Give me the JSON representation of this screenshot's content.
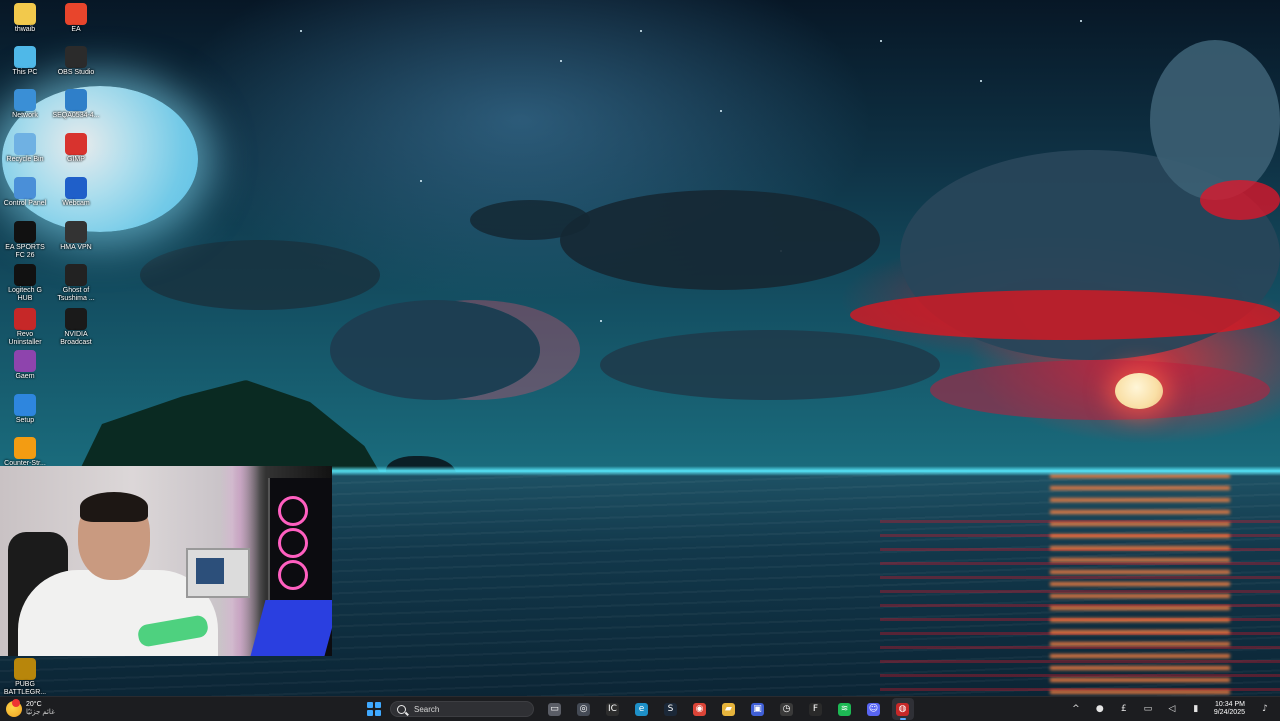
{
  "desktop": {
    "icons": [
      {
        "label": "thwaib",
        "icon": "folder-icon",
        "color": "#f2c94c"
      },
      {
        "label": "EA",
        "icon": "ea-icon",
        "color": "#e8452c"
      },
      {
        "label": "This PC",
        "icon": "monitor-icon",
        "color": "#4fb8e8"
      },
      {
        "label": "OBS Studio",
        "icon": "obs-icon",
        "color": "#2b2b2b"
      },
      {
        "label": "Network",
        "icon": "network-icon",
        "color": "#3a8fd6"
      },
      {
        "label": "SEQA0534-4...",
        "icon": "file-icon",
        "color": "#2f7fc9"
      },
      {
        "label": "Recycle Bin",
        "icon": "recycle-bin-icon",
        "color": "#6fb1e3"
      },
      {
        "label": "GIMP",
        "icon": "pinterest-icon",
        "color": "#d8332e"
      },
      {
        "label": "Control Panel",
        "icon": "control-panel-icon",
        "color": "#4a8fd8"
      },
      {
        "label": "Webcam",
        "icon": "webcam-icon",
        "color": "#1f5fc9"
      },
      {
        "label": "EA SPORTS FC 26",
        "icon": "ea-sports-icon",
        "color": "#111111"
      },
      {
        "label": "HMA VPN",
        "icon": "hma-vpn-icon",
        "color": "#333333"
      },
      {
        "label": "Logitech G HUB",
        "icon": "logitech-icon",
        "color": "#111111"
      },
      {
        "label": "Ghost of Tsushima ...",
        "icon": "ghost-of-tsushima-icon",
        "color": "#222222"
      },
      {
        "label": "Revo Uninstaller",
        "icon": "revo-uninstaller-icon",
        "color": "#c62828"
      },
      {
        "label": "NVIDIA Broadcast",
        "icon": "nvidia-icon",
        "color": "#1a1a1a"
      },
      {
        "label": "Gaem",
        "icon": "gaem-icon",
        "color": "#8e44ad"
      },
      {
        "label": "Setup",
        "icon": "setup-icon",
        "color": "#2e86de"
      },
      {
        "label": "Counter-Str...",
        "icon": "counter-strike-icon",
        "color": "#f39c12"
      },
      {
        "label": "PUBG BATTLEGR...",
        "icon": "pubg-icon",
        "color": "#b8860b"
      }
    ]
  },
  "webcam": {
    "name": "webcam-overlay"
  },
  "taskbar": {
    "weather": {
      "temp": "20°C",
      "desc": "غائم جزئيًا"
    },
    "search": {
      "placeholder": "Search"
    },
    "apps": [
      {
        "name": "task-view",
        "icon": "task-view-icon",
        "glyph": "▭",
        "color": "#5a5d66"
      },
      {
        "name": "copilot",
        "icon": "copilot-icon",
        "glyph": "◎",
        "color": "#444a55"
      },
      {
        "name": "ubisoft",
        "icon": "ubisoft-icon",
        "glyph": "IC",
        "color": "#2d2d2d"
      },
      {
        "name": "edge",
        "icon": "edge-icon",
        "glyph": "e",
        "color": "#1e90c8"
      },
      {
        "name": "steam",
        "icon": "steam-icon",
        "glyph": "S",
        "color": "#1b2838"
      },
      {
        "name": "chrome",
        "icon": "chrome-icon",
        "glyph": "◉",
        "color": "#db4437"
      },
      {
        "name": "file-explorer",
        "icon": "folder-icon",
        "glyph": "▰",
        "color": "#e6b43c"
      },
      {
        "name": "ea-app",
        "icon": "ea-app-icon",
        "glyph": "▣",
        "color": "#3f5fd6"
      },
      {
        "name": "clock-app",
        "icon": "clock-icon",
        "glyph": "◷",
        "color": "#3a3a3a"
      },
      {
        "name": "epic-games",
        "icon": "epic-games-icon",
        "glyph": "F",
        "color": "#2a2a2a"
      },
      {
        "name": "spotify",
        "icon": "spotify-icon",
        "glyph": "≋",
        "color": "#1db954"
      },
      {
        "name": "discord",
        "icon": "discord-icon",
        "glyph": "☺",
        "color": "#5865f2"
      },
      {
        "name": "obs",
        "icon": "obs-icon",
        "glyph": "◍",
        "color": "#c62828"
      }
    ],
    "tray": [
      {
        "name": "tray-chevron",
        "icon": "chevron-up-icon",
        "glyph": "^"
      },
      {
        "name": "tray-mic",
        "icon": "microphone-icon",
        "glyph": "●"
      },
      {
        "name": "tray-currency",
        "icon": "currency-icon",
        "glyph": "£"
      },
      {
        "name": "tray-network",
        "icon": "network-icon",
        "glyph": "▭"
      },
      {
        "name": "tray-volume",
        "icon": "volume-icon",
        "glyph": "◁"
      },
      {
        "name": "tray-battery",
        "icon": "battery-icon",
        "glyph": "▮"
      }
    ],
    "clock": {
      "time": "10:34 PM",
      "date": "9/24/2025"
    },
    "notifications": {
      "icon": "notification-bell-icon",
      "glyph": "♪"
    }
  }
}
